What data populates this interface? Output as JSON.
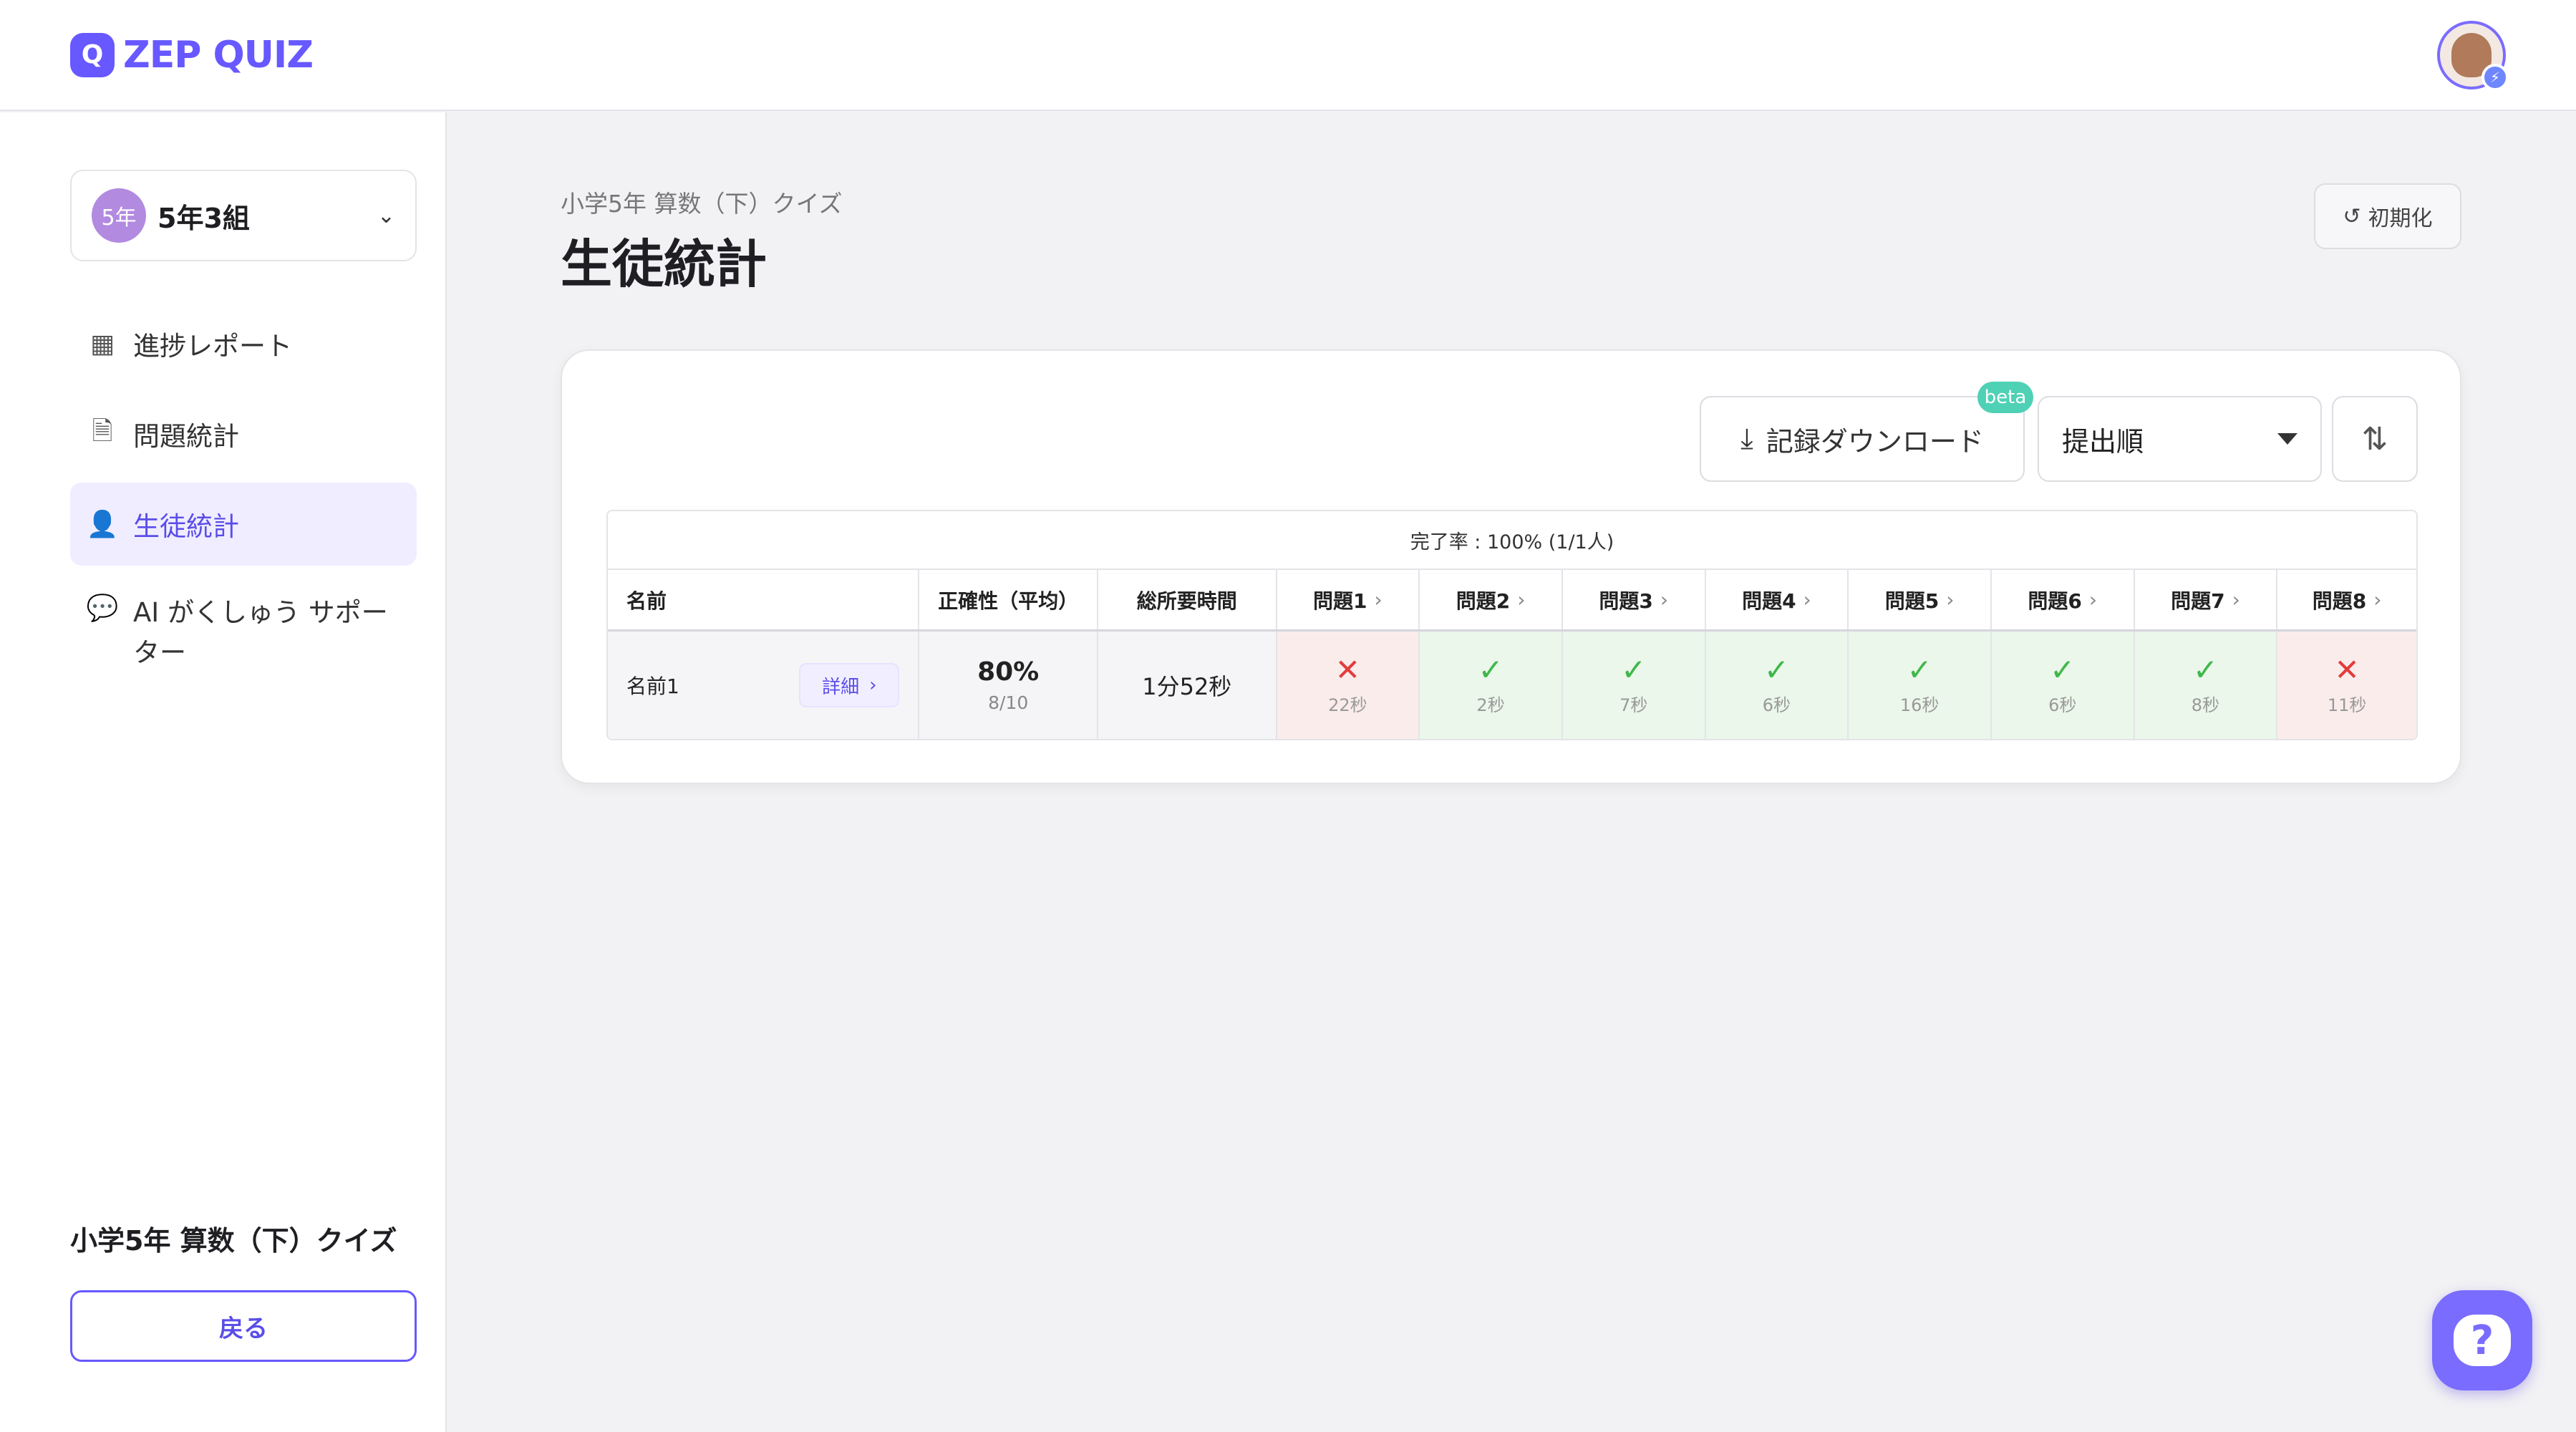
{
  "app": {
    "logo_mark": "Q",
    "logo_text": "ZEP QUIZ",
    "accent_color": "#6758ff"
  },
  "sidebar": {
    "grade_badge": "5年",
    "class_name": "5年3組",
    "items": [
      {
        "label": "進捗レポート",
        "icon": "grid-icon"
      },
      {
        "label": "問題統計",
        "icon": "document-icon"
      },
      {
        "label": "生徒統計",
        "icon": "users-icon",
        "active": true
      },
      {
        "label": "AI がくしゅう サポーター",
        "icon": "chat-icon"
      }
    ],
    "quiz_title": "小学5年 算数（下）クイズ",
    "back_label": "戻る"
  },
  "header": {
    "subtitle": "小学5年 算数（下）クイズ",
    "title": "生徒統計",
    "reset_label": "初期化"
  },
  "toolbar": {
    "download_label": "記録ダウンロード",
    "beta_label": "beta",
    "sort_value": "提出順"
  },
  "table": {
    "completion": "完了率 : 100% (1/1人)",
    "headers": {
      "name": "名前",
      "accuracy": "正確性（平均）",
      "time": "総所要時間",
      "questions": [
        "問題1",
        "問題2",
        "問題3",
        "問題4",
        "問題5",
        "問題6",
        "問題7",
        "問題8"
      ]
    },
    "rows": [
      {
        "name": "名前1",
        "detail_label": "詳細",
        "accuracy": "80%",
        "score": "8/10",
        "total_time": "1分52秒",
        "answers": [
          {
            "correct": false,
            "time": "22秒"
          },
          {
            "correct": true,
            "time": "2秒"
          },
          {
            "correct": true,
            "time": "7秒"
          },
          {
            "correct": true,
            "time": "6秒"
          },
          {
            "correct": true,
            "time": "16秒"
          },
          {
            "correct": true,
            "time": "6秒"
          },
          {
            "correct": true,
            "time": "8秒"
          },
          {
            "correct": false,
            "time": "11秒"
          }
        ]
      }
    ]
  },
  "help": {
    "symbol": "?"
  }
}
